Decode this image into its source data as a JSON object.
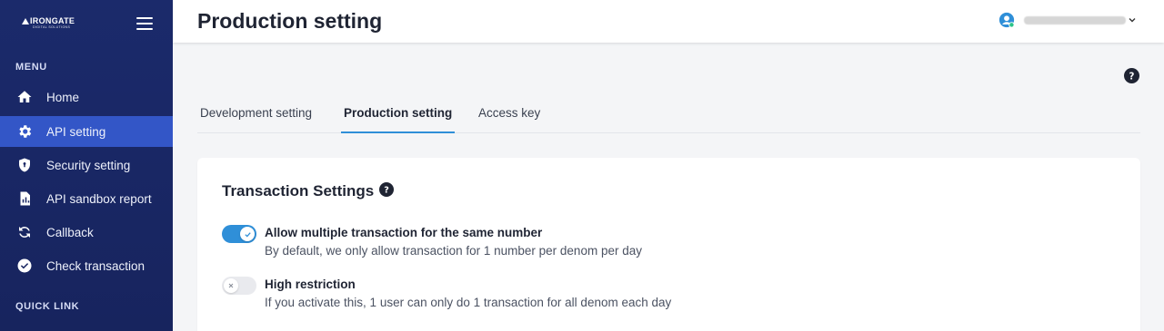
{
  "brand": {
    "name": "IRONGATE",
    "tagline": "DIGITAL SOLUTIONS"
  },
  "sidebar": {
    "menu_heading": "MENU",
    "items": [
      {
        "label": "Home",
        "icon": "home-icon",
        "active": false
      },
      {
        "label": "API setting",
        "icon": "gear-icon",
        "active": true
      },
      {
        "label": "Security setting",
        "icon": "shield-icon",
        "active": false
      },
      {
        "label": "API sandbox report",
        "icon": "report-icon",
        "active": false
      },
      {
        "label": "Callback",
        "icon": "callback-icon",
        "active": false
      },
      {
        "label": "Check transaction",
        "icon": "check-circle-icon",
        "active": false
      }
    ],
    "quick_link_heading": "QUICK LINK"
  },
  "header": {
    "title": "Production setting"
  },
  "tabs": [
    {
      "label": "Development setting",
      "active": false
    },
    {
      "label": "Production setting",
      "active": true
    },
    {
      "label": "Access key",
      "active": false
    }
  ],
  "card": {
    "title": "Transaction Settings",
    "settings": [
      {
        "title": "Allow multiple transaction for the same number",
        "description": "By default, we only allow transaction for 1 number per denom per day",
        "enabled": true
      },
      {
        "title": "High restriction",
        "description": "If you activate this, 1 user can only do 1 transaction for all denom each day",
        "enabled": false
      }
    ]
  },
  "colors": {
    "sidebar_bg": "#1b2a6b",
    "active_nav": "#3356c7",
    "accent": "#2f8fd8",
    "status_online": "#2bc48a"
  }
}
